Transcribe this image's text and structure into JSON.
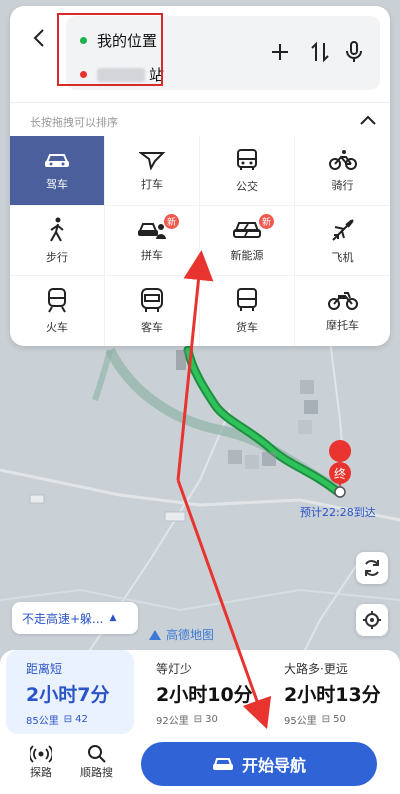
{
  "colors": {
    "accent": "#2f63d6",
    "route": "#1bb24b",
    "highlight": "#d72a2a",
    "active_mode": "#4a5f9c"
  },
  "search": {
    "from_label": "我的位置",
    "to_label_suffix": "站",
    "back_icon": "back-arrow-icon",
    "tools": [
      "add-icon",
      "swap-icon",
      "microphone-icon"
    ]
  },
  "modes": {
    "hint": "长按拖拽可以排序",
    "items": [
      {
        "label": "驾车",
        "icon": "car-icon",
        "active": true
      },
      {
        "label": "打车",
        "icon": "taxi-flag-icon"
      },
      {
        "label": "公交",
        "icon": "bus-icon"
      },
      {
        "label": "骑行",
        "icon": "bicycle-icon"
      },
      {
        "label": "步行",
        "icon": "walk-icon"
      },
      {
        "label": "拼车",
        "icon": "carpool-icon",
        "badge": "新"
      },
      {
        "label": "新能源",
        "icon": "ev-car-icon",
        "badge": "新"
      },
      {
        "label": "飞机",
        "icon": "plane-icon"
      },
      {
        "label": "火车",
        "icon": "train-icon"
      },
      {
        "label": "客车",
        "icon": "coach-icon"
      },
      {
        "label": "货车",
        "icon": "truck-icon"
      },
      {
        "label": "摩托车",
        "icon": "motorcycle-icon"
      }
    ]
  },
  "map": {
    "end_marker": "终",
    "eta": "预计22:28到达",
    "brand": "高德地图"
  },
  "preference": {
    "label": "不走高速+躲..."
  },
  "plans": [
    {
      "tag": "距离短",
      "duration": "2小时7分",
      "distance": "85公里",
      "lights": "42",
      "selected": true
    },
    {
      "tag": "等灯少",
      "duration": "2小时10分",
      "distance": "92公里",
      "lights": "30"
    },
    {
      "tag": "大路多·更远",
      "duration": "2小时13分",
      "distance": "95公里",
      "lights": "50"
    }
  ],
  "actions": [
    {
      "label": "探路",
      "icon": "radar-icon"
    },
    {
      "label": "顺路搜",
      "icon": "search-icon"
    }
  ],
  "start_nav": {
    "label": "开始导航"
  }
}
